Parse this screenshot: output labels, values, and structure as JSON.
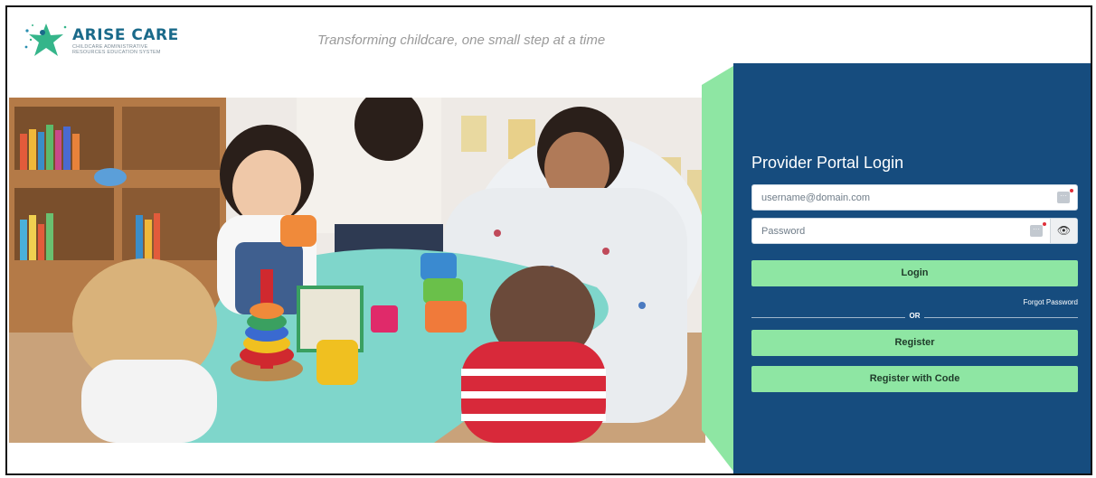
{
  "brand": {
    "name": "ARISE CARE",
    "subtitle": "CHILDCARE ADMINISTRATIVE RESOURCES EDUCATION SYSTEM",
    "tagline": "Transforming childcare, one small step at a time"
  },
  "hero_image": {
    "description_icon": "classroom-photo"
  },
  "login": {
    "title": "Provider Portal Login",
    "username_placeholder": "username@domain.com",
    "password_placeholder": "Password",
    "login_label": "Login",
    "forgot_label": "Forgot Password",
    "or_label": "OR",
    "register_label": "Register",
    "register_code_label": "Register with Code"
  },
  "colors": {
    "panel": "#164c7e",
    "accent_green": "#8ee6a3",
    "brand_blue": "#1a6a8a"
  }
}
